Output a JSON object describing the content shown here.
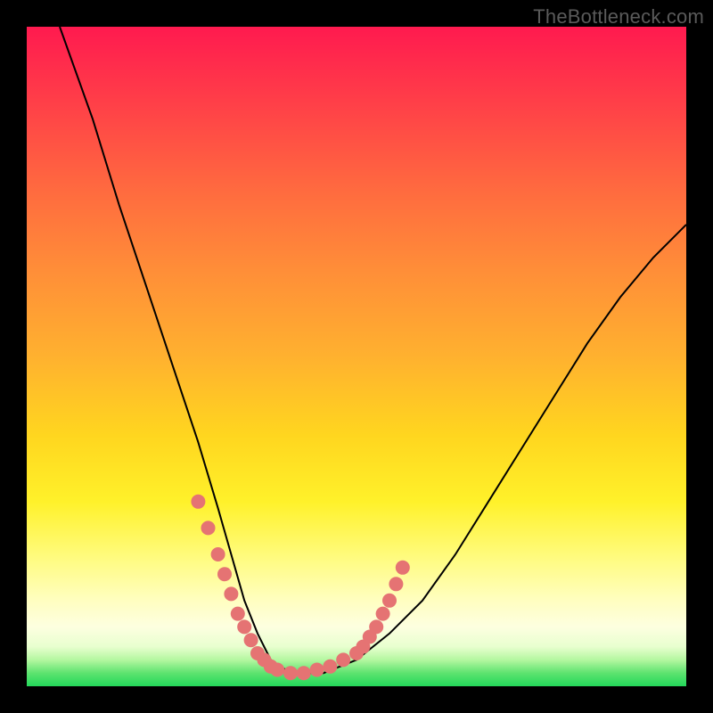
{
  "watermark": "TheBottleneck.com",
  "chart_data": {
    "type": "line",
    "title": "",
    "xlabel": "",
    "ylabel": "",
    "xlim": [
      0,
      100
    ],
    "ylim": [
      0,
      100
    ],
    "series": [
      {
        "name": "bottleneck-curve",
        "x": [
          5,
          10,
          14,
          18,
          22,
          26,
          29,
          31,
          33,
          35,
          37,
          40,
          45,
          50,
          55,
          60,
          65,
          70,
          75,
          80,
          85,
          90,
          95,
          100
        ],
        "values": [
          100,
          86,
          73,
          61,
          49,
          37,
          27,
          20,
          13,
          8,
          4,
          2,
          2,
          4,
          8,
          13,
          20,
          28,
          36,
          44,
          52,
          59,
          65,
          70
        ]
      }
    ],
    "markers": {
      "name": "highlight-dots",
      "color": "#e57373",
      "x": [
        26,
        27.5,
        29,
        30,
        31,
        32,
        33,
        34,
        35,
        36,
        37,
        38,
        40,
        42,
        44,
        46,
        48,
        50,
        51,
        52,
        53,
        54,
        55,
        56,
        57
      ],
      "values": [
        28,
        24,
        20,
        17,
        14,
        11,
        9,
        7,
        5,
        4,
        3,
        2.5,
        2,
        2,
        2.5,
        3,
        4,
        5,
        6,
        7.5,
        9,
        11,
        13,
        15.5,
        18
      ]
    }
  }
}
